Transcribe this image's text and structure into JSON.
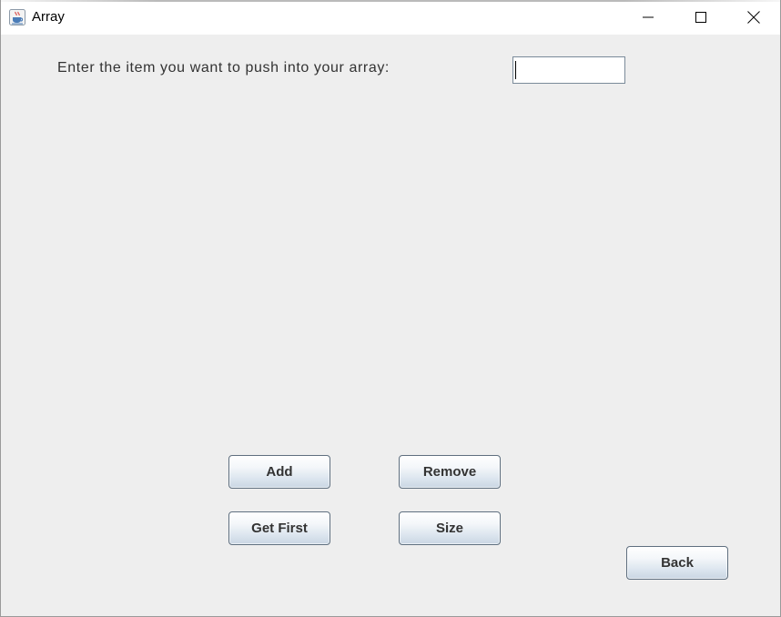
{
  "window": {
    "title": "Array",
    "app_icon": "java-cup-icon",
    "controls": {
      "minimize_icon": "minimize-icon",
      "maximize_icon": "maximize-icon",
      "close_icon": "close-icon"
    }
  },
  "form": {
    "prompt_label": "Enter the item you want to push into your array:",
    "item_input_value": "",
    "item_input_placeholder": ""
  },
  "buttons": {
    "add": "Add",
    "remove": "Remove",
    "get_first": "Get First",
    "size": "Size",
    "back": "Back"
  },
  "colors": {
    "window_background": "#eeeeee",
    "titlebar_background": "#ffffff",
    "button_border": "#5f6f7f",
    "button_text": "#333333",
    "label_text": "#333333"
  }
}
